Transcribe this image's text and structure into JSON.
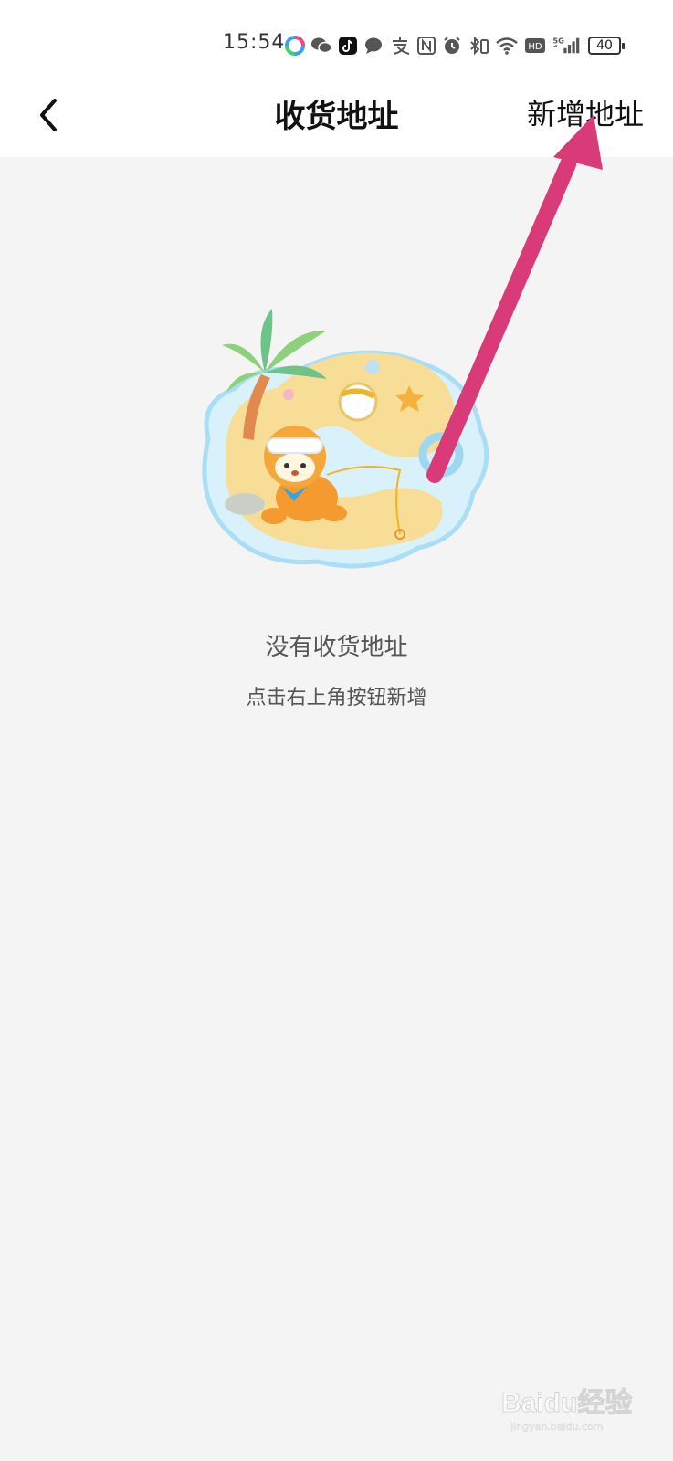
{
  "status_bar": {
    "time": "15:54",
    "battery": "40",
    "network_badge": "HD",
    "network_type": "5G",
    "icons": [
      "assistant-icon",
      "wechat-icon",
      "douyin-icon",
      "message-icon",
      "alipay-icon",
      "nfc-icon",
      "alarm-icon",
      "bluetooth-icon",
      "wifi-icon",
      "hd-icon",
      "signal-icon"
    ]
  },
  "header": {
    "title": "收货地址",
    "action_label": "新增地址"
  },
  "empty_state": {
    "title": "没有收货地址",
    "subtitle": "点击右上角按钮新增"
  },
  "annotation": {
    "arrow_color": "#d93a78"
  },
  "watermark": {
    "text": "Baidu经验",
    "url": "jingyan.baidu.com"
  }
}
